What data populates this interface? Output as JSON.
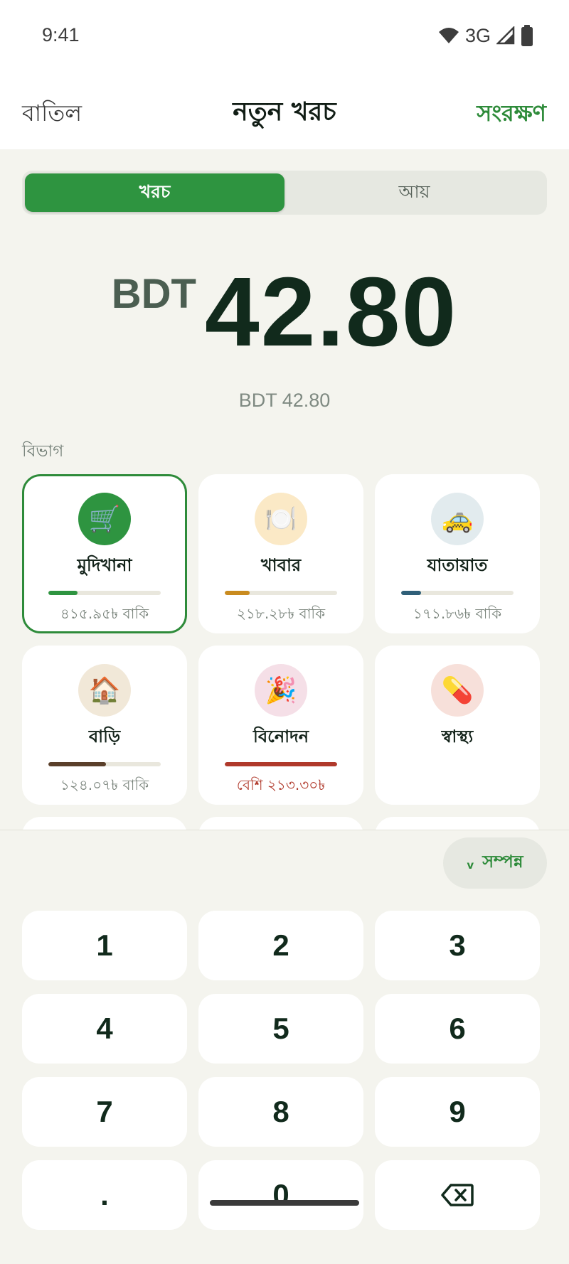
{
  "status": {
    "time": "9:41",
    "network": "3G"
  },
  "nav": {
    "cancel": "বাতিল",
    "title": "নতুন খরচ",
    "save": "সংরক্ষণ"
  },
  "segment": {
    "expense": "খরচ",
    "income": "আয়",
    "active": "expense"
  },
  "amount": {
    "currency": "BDT",
    "value": "42.80",
    "sub": "BDT 42.80"
  },
  "categories_label": "বিভাগ",
  "categories": [
    {
      "name": "মুদিখানা",
      "icon": "🛒",
      "icon_name": "shopping-cart-icon",
      "icon_bg": "#2e9440",
      "bar_color": "#2e9440",
      "progress": 0.26,
      "remaining": "৪১৫.৯৫৳ বাকি",
      "selected": true
    },
    {
      "name": "খাবার",
      "icon": "🍽️",
      "icon_name": "plate-cutlery-icon",
      "icon_bg": "#fbe9c6",
      "bar_color": "#c98b1f",
      "progress": 0.22,
      "remaining": "২১৮.২৮৳ বাকি"
    },
    {
      "name": "যাতায়াত",
      "icon": "🚕",
      "icon_name": "taxi-icon",
      "icon_bg": "#e2ebee",
      "bar_color": "#2f5f78",
      "progress": 0.18,
      "remaining": "১৭১.৮৬৳ বাকি"
    },
    {
      "name": "বাড়ি",
      "icon": "🏠",
      "icon_name": "house-icon",
      "icon_bg": "#f1e8d8",
      "bar_color": "#5a3f2a",
      "progress": 0.51,
      "remaining": "১২৪.০৭৳ বাকি"
    },
    {
      "name": "বিনোদন",
      "icon": "🎉",
      "icon_name": "party-popper-icon",
      "icon_bg": "#f5dfe7",
      "bar_color": "#b0392b",
      "progress": 1.0,
      "remaining": "বেশি ২১৩.৩০৳",
      "over": true
    },
    {
      "name": "স্বাস্থ্য",
      "icon": "💊",
      "icon_name": "pill-icon",
      "icon_bg": "#f7e0da",
      "bar_color": "",
      "progress": null,
      "remaining": ""
    }
  ],
  "done": {
    "label": "সম্পন্ন",
    "chevron": "v"
  },
  "keys": [
    "1",
    "2",
    "3",
    "4",
    "5",
    "6",
    "7",
    "8",
    "9",
    ".",
    "0",
    "⌫"
  ],
  "colors": {
    "accent": "#2e8b3a",
    "danger": "#b0392b",
    "background": "#f4f4ee"
  }
}
